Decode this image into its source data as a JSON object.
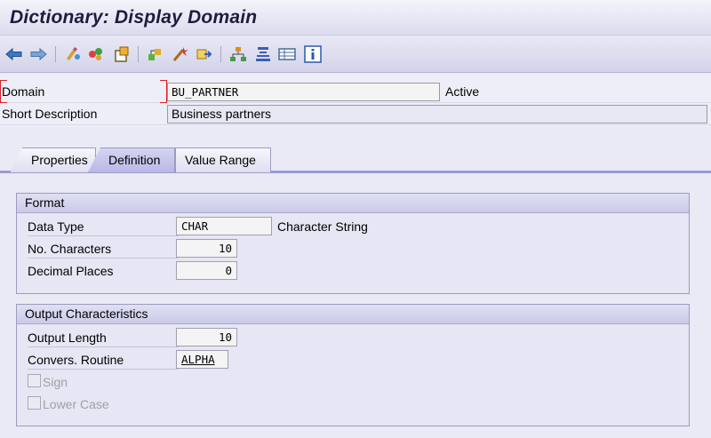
{
  "title": "Dictionary: Display Domain",
  "toolbar": {
    "icons": [
      "back-icon",
      "forward-icon",
      "other-object-icon",
      "display-change-icon",
      "active-inactive-icon",
      "where-used-icon",
      "check-icon",
      "activate-icon",
      "hierarchy-icon",
      "text-align-icon",
      "table-icon",
      "info-icon"
    ]
  },
  "header": {
    "domain_label": "Domain",
    "domain_value": "BU_PARTNER",
    "status": "Active",
    "short_desc_label": "Short Description",
    "short_desc_value": "Business partners"
  },
  "tabs": [
    {
      "label": "Properties",
      "active": false
    },
    {
      "label": "Definition",
      "active": true
    },
    {
      "label": "Value Range",
      "active": false
    }
  ],
  "format": {
    "title": "Format",
    "data_type_label": "Data Type",
    "data_type_value": "CHAR",
    "data_type_desc": "Character String",
    "no_chars_label": "No. Characters",
    "no_chars_value": "10",
    "decimal_label": "Decimal Places",
    "decimal_value": "0"
  },
  "output": {
    "title": "Output Characteristics",
    "length_label": "Output Length",
    "length_value": "10",
    "conv_label": "Convers. Routine",
    "conv_value": "ALPHA",
    "sign_label": "Sign",
    "sign_checked": false,
    "lower_label": "Lower Case",
    "lower_checked": false
  },
  "colors": {
    "accent": "#9b9bd2",
    "background": "#eaeaf6",
    "title_text": "#1c1c40"
  }
}
